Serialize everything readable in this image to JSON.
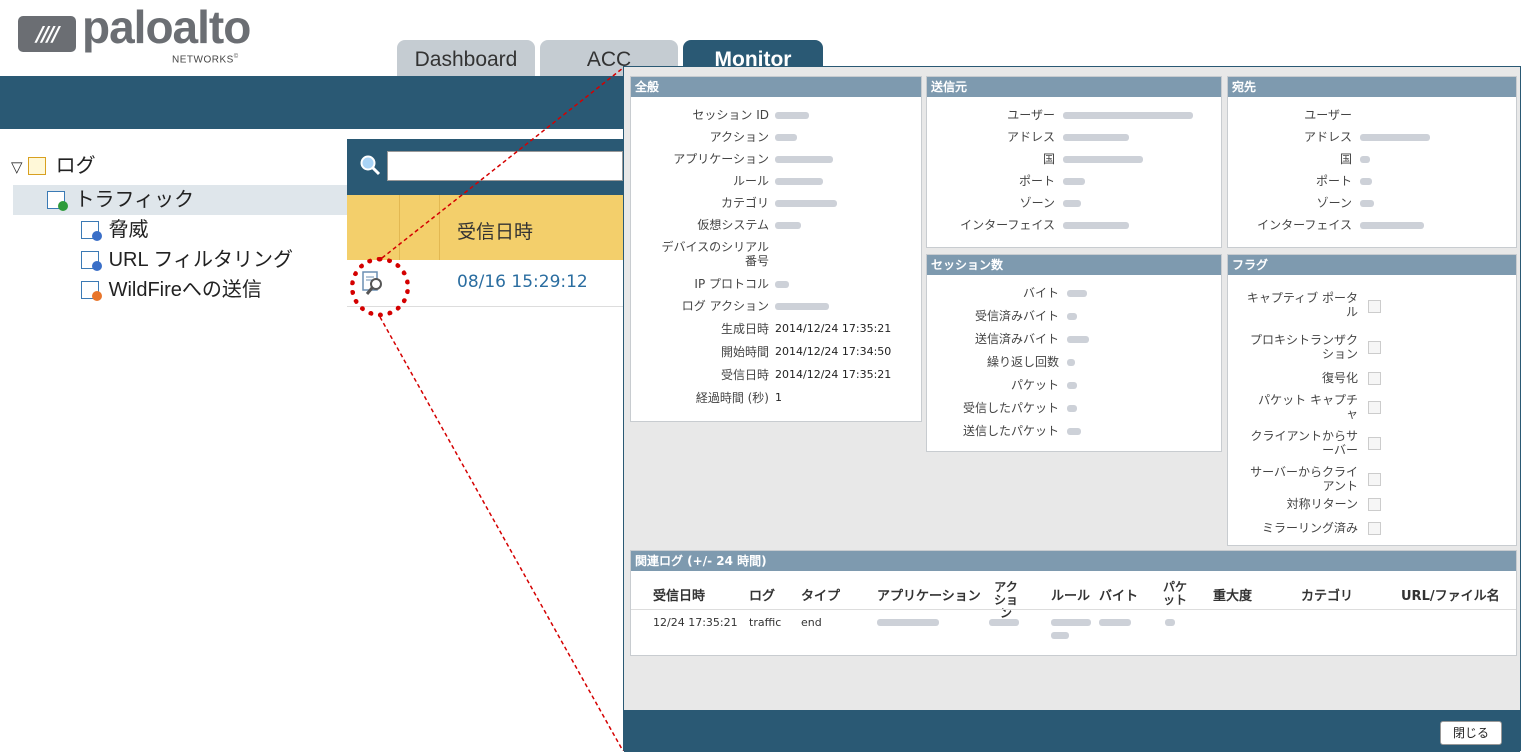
{
  "brand": {
    "name": "paloalto",
    "sub": "NETWORKS",
    "mark": "////"
  },
  "tabs": [
    {
      "label": "Dashboard"
    },
    {
      "label": "ACC"
    },
    {
      "label": "Monitor",
      "active": true
    }
  ],
  "sidebar": {
    "root": {
      "label": "ログ",
      "toggle": "▽"
    },
    "items": [
      {
        "label": "トラフィック",
        "selected": true
      },
      {
        "label": "脅威"
      },
      {
        "label": "URL フィルタリング"
      },
      {
        "label": "WildFireへの送信"
      }
    ]
  },
  "log_grid": {
    "search_icon": "search-icon",
    "column_header": "受信日時",
    "row_time": "08/16 15:29:12",
    "detail_icon": "magnifier-detail-icon"
  },
  "modal": {
    "general": {
      "title": "全般",
      "labels": [
        "セッション ID",
        "アクション",
        "アプリケーション",
        "ルール",
        "カテゴリ",
        "仮想システム",
        "デバイスのシリアル番号",
        "IP プロトコル",
        "ログ アクション",
        "生成日時",
        "開始時間",
        "受信日時",
        "経過時間 (秒)"
      ],
      "generated": "2014/12/24 17:35:21",
      "start_time": "2014/12/24 17:34:50",
      "received": "2014/12/24 17:35:21",
      "elapsed": "1"
    },
    "source": {
      "title": "送信元",
      "labels": [
        "ユーザー",
        "アドレス",
        "国",
        "ポート",
        "ゾーン",
        "インターフェイス"
      ]
    },
    "destination": {
      "title": "宛先",
      "labels": [
        "ユーザー",
        "アドレス",
        "国",
        "ポート",
        "ゾーン",
        "インターフェイス"
      ]
    },
    "session_counts": {
      "title": "セッション数",
      "labels": [
        "バイト",
        "受信済みバイト",
        "送信済みバイト",
        "繰り返し回数",
        "パケット",
        "受信したパケット",
        "送信したパケット"
      ]
    },
    "flags": {
      "title": "フラグ",
      "labels": [
        "キャプティブ ポータル",
        "プロキシトランザクション",
        "復号化",
        "パケット キャプチャ",
        "クライアントからサーバー",
        "サーバーからクライアント",
        "対称リターン",
        "ミラーリング済み"
      ]
    },
    "related_logs": {
      "title": "関連ログ (+/- 24 時間)",
      "columns": [
        "受信日時",
        "ログ",
        "タイプ",
        "アプリケーション",
        "アクション",
        "ルール",
        "バイト",
        "パケット",
        "重大度",
        "カテゴリ",
        "URL/ファイル名"
      ],
      "row": {
        "received": "12/24 17:35:21",
        "log": "traffic",
        "type": "end"
      }
    },
    "close_label": "閉じる"
  }
}
